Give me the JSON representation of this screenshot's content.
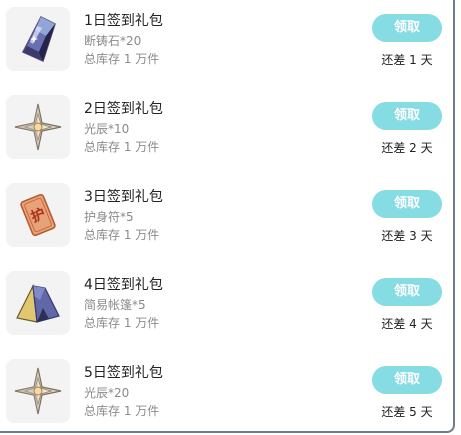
{
  "items": [
    {
      "title": "1日签到礼包",
      "reward": "断铸石*20",
      "stock": "总库存 1 万件",
      "claim_label": "领取",
      "remaining": "还差 1 天",
      "icon": "crystal-icon"
    },
    {
      "title": "2日签到礼包",
      "reward": "光辰*10",
      "stock": "总库存 1 万件",
      "claim_label": "领取",
      "remaining": "还差 2 天",
      "icon": "star-icon"
    },
    {
      "title": "3日签到礼包",
      "reward": "护身符*5",
      "stock": "总库存 1 万件",
      "claim_label": "领取",
      "remaining": "还差 3 天",
      "icon": "amulet-icon",
      "icon_text": "护"
    },
    {
      "title": "4日签到礼包",
      "reward": "简易帐篷*5",
      "stock": "总库存 1 万件",
      "claim_label": "领取",
      "remaining": "还差 4 天",
      "icon": "tent-icon"
    },
    {
      "title": "5日签到礼包",
      "reward": "光辰*20",
      "stock": "总库存 1 万件",
      "claim_label": "领取",
      "remaining": "还差 5 天",
      "icon": "star-icon"
    }
  ],
  "colors": {
    "claim_button": "#86dce3",
    "title_text": "#222222",
    "sub_text": "#8a8a8a",
    "thumb_bg": "#f3f3f3",
    "panel_border": "#6d7d8e"
  }
}
